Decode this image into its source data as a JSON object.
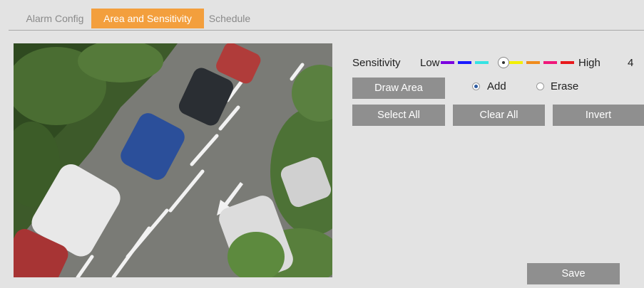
{
  "tabs": [
    {
      "label": "Alarm Config",
      "active": false
    },
    {
      "label": "Area and Sensitivity",
      "active": true
    },
    {
      "label": "Schedule",
      "active": false
    }
  ],
  "sensitivity": {
    "label": "Sensitivity",
    "low_label": "Low",
    "high_label": "High",
    "value": "4",
    "min": 1,
    "max": 8,
    "segment_colors": [
      "#7b00e0",
      "#1a1aff",
      "#35e3e3",
      "#8a8a8a",
      "#f3f000",
      "#f08c1c",
      "#f0177a",
      "#e8191c"
    ]
  },
  "buttons": {
    "draw_area": "Draw Area",
    "select_all": "Select All",
    "clear_all": "Clear All",
    "invert": "Invert",
    "save": "Save"
  },
  "mode": {
    "add_label": "Add",
    "erase_label": "Erase",
    "selected": "Add"
  },
  "colors": {
    "active_tab": "#f39f3d",
    "button": "#8f8f8f",
    "background": "#e3e3e3"
  }
}
